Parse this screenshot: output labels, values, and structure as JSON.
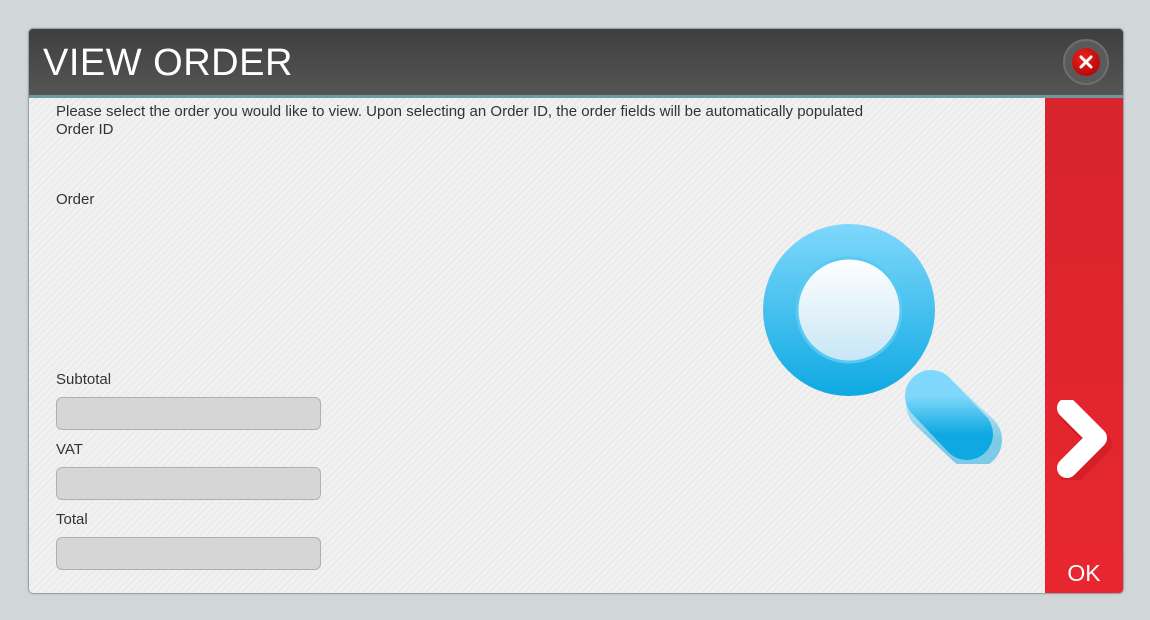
{
  "dialog": {
    "title": "VIEW ORDER",
    "close_icon": "close-icon",
    "instructions": "Please select the order you would like to view. Upon selecting an Order ID, the order fields will be automatically populated",
    "labels": {
      "order_id": "Order ID",
      "order": "Order",
      "subtotal": "Subtotal",
      "vat": "VAT",
      "total": "Total"
    },
    "fields": {
      "subtotal": "",
      "vat": "",
      "total": ""
    },
    "illustration_icon": "magnifier-icon",
    "ok": {
      "label": "OK",
      "icon": "chevron-right-icon"
    }
  },
  "colors": {
    "titlebar": "#4a4a4a",
    "accent_red": "#e0252e",
    "magnifier_blue": "#19b3e8"
  }
}
